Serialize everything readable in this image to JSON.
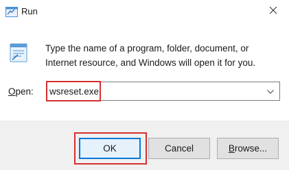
{
  "window": {
    "title": "Run",
    "app_icon": "run-app-icon",
    "close_icon": "close-icon"
  },
  "description": {
    "line1": "Type the name of a program, folder, document, or",
    "line2": "Internet resource, and Windows will open it for you."
  },
  "open_field": {
    "label_mnemonic": "O",
    "label_rest": "pen:",
    "value": "wsreset.exe",
    "dropdown_icon": "chevron-down-icon"
  },
  "buttons": {
    "ok": "OK",
    "cancel": "Cancel",
    "browse_mnemonic": "B",
    "browse_rest": "rowse..."
  },
  "colors": {
    "highlight": "#d32f2f",
    "focus_border": "#0078d7",
    "footer_bg": "#f0f0f0"
  }
}
